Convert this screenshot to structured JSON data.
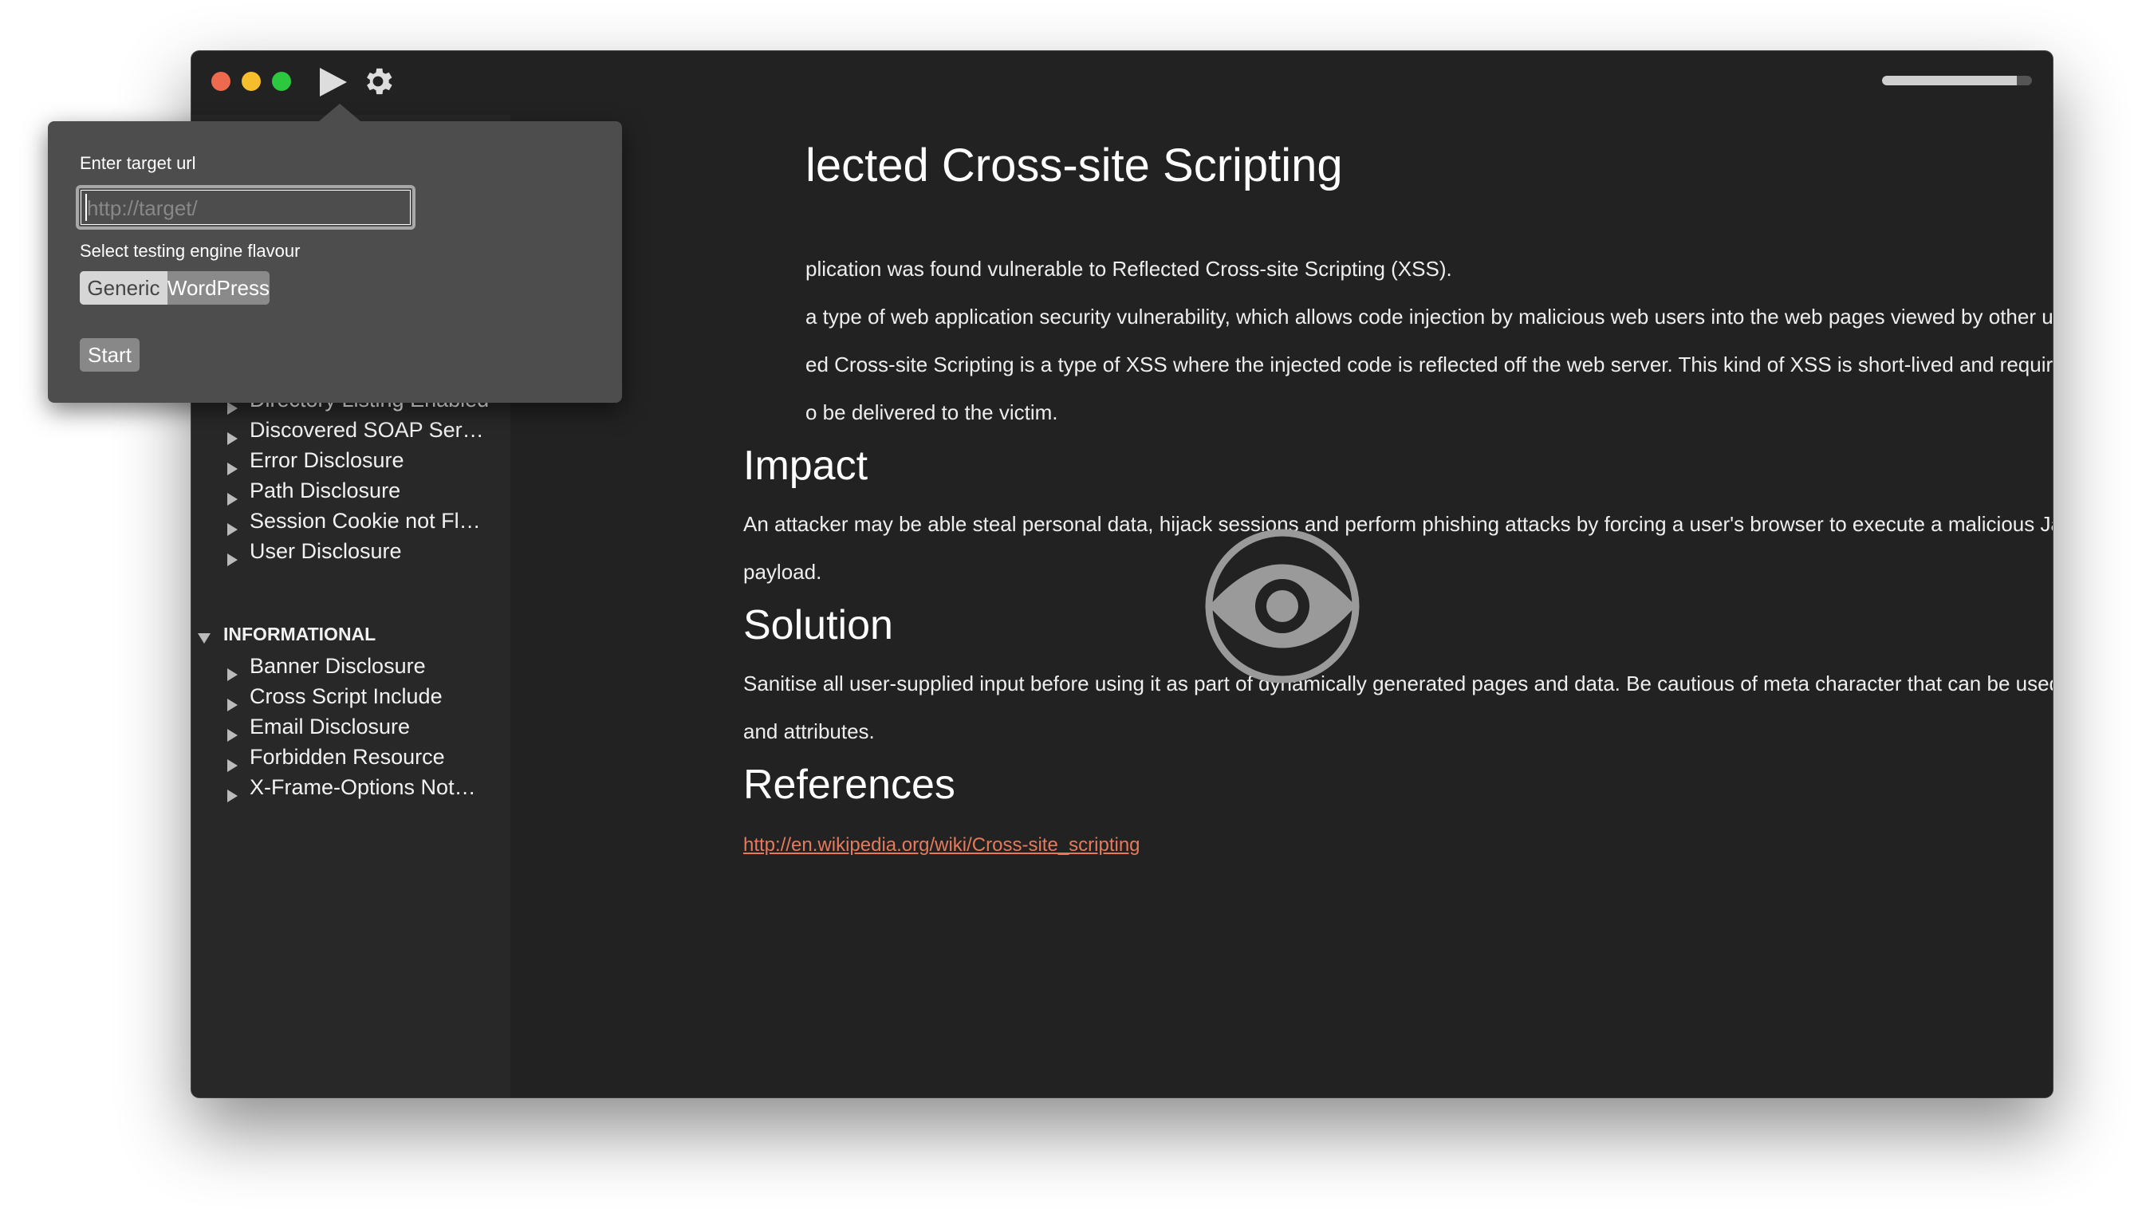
{
  "toolbar": {
    "play_icon": "play-icon",
    "settings_icon": "gear-icon",
    "progress_percent": 90
  },
  "popover": {
    "url_label": "Enter target url",
    "url_value": "",
    "url_placeholder": "http://target/",
    "flavour_label": "Select testing engine flavour",
    "flavours": [
      "Generic",
      "WordPress"
    ],
    "selected_flavour": "WordPress",
    "start_label": "Start"
  },
  "sidebar": {
    "partial_item": "Directory Listing Enabled",
    "items_a": [
      "Discovered SOAP Ser…",
      "Error Disclosure",
      "Path Disclosure",
      "Session Cookie not Fl…",
      "User Disclosure"
    ],
    "section": "INFORMATIONAL",
    "items_b": [
      "Banner Disclosure",
      "Cross Script Include",
      "Email Disclosure",
      "Forbidden Resource",
      "X-Frame-Options Not…"
    ]
  },
  "content": {
    "title_visible": "lected Cross-site Scripting",
    "intro_lines": [
      "plication was found vulnerable to Reflected Cross-site Scripting (XSS).",
      "a type of web application security vulnerability, which allows code injection by malicious web users into the web pages viewed by other users.",
      "ed Cross-site Scripting is a type of XSS where the injected code is reflected off the web server. This kind of XSS is short-lived and requires a phishing",
      "o be delivered to the victim."
    ],
    "impact_heading": "Impact",
    "impact_lines": [
      "An attacker may be able steal personal data, hijack sessions and perform phishing attacks by forcing a user's browser to execute a malicious JavaScript",
      "payload."
    ],
    "solution_heading": "Solution",
    "solution_lines": [
      "Sanitise all user-supplied input before using it as part of dynamically generated pages and data. Be cautious of meta character that can be used to build tags",
      "and attributes."
    ],
    "references_heading": "References",
    "reference_link": "http://en.wikipedia.org/wiki/Cross-site_scripting",
    "link_color": "#e8795a"
  }
}
